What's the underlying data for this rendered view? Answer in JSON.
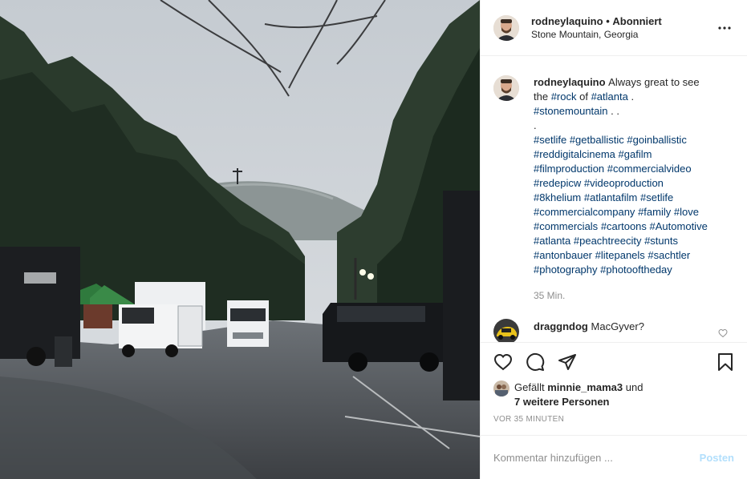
{
  "header": {
    "username": "rodneylaquino",
    "separator": "•",
    "follow_status": "Abonniert",
    "location": "Stone Mountain, Georgia"
  },
  "caption": {
    "username": "rodneylaquino",
    "lines": [
      {
        "parts": [
          {
            "t": "Always great to see",
            "tag": false
          }
        ]
      },
      {
        "parts": [
          {
            "t": "the ",
            "tag": false
          },
          {
            "t": "#rock",
            "tag": true
          },
          {
            "t": " of ",
            "tag": false
          },
          {
            "t": "#atlanta",
            "tag": true
          },
          {
            "t": " .",
            "tag": false
          }
        ]
      },
      {
        "parts": [
          {
            "t": "#stonemountain",
            "tag": true
          },
          {
            "t": " . .",
            "tag": false
          }
        ]
      },
      {
        "parts": [
          {
            "t": ".",
            "tag": false
          }
        ]
      },
      {
        "parts": [
          {
            "t": "#setlife",
            "tag": true
          },
          {
            "t": " ",
            "tag": false
          },
          {
            "t": "#getballistic",
            "tag": true
          },
          {
            "t": " ",
            "tag": false
          },
          {
            "t": "#goinballistic",
            "tag": true
          }
        ]
      },
      {
        "parts": [
          {
            "t": "#reddigitalcinema",
            "tag": true
          },
          {
            "t": " ",
            "tag": false
          },
          {
            "t": "#gafilm",
            "tag": true
          }
        ]
      },
      {
        "parts": [
          {
            "t": "#filmproduction",
            "tag": true
          },
          {
            "t": " ",
            "tag": false
          },
          {
            "t": "#commercialvideo",
            "tag": true
          }
        ]
      },
      {
        "parts": [
          {
            "t": "#redepicw",
            "tag": true
          },
          {
            "t": " ",
            "tag": false
          },
          {
            "t": "#videoproduction",
            "tag": true
          }
        ]
      },
      {
        "parts": [
          {
            "t": "#8khelium",
            "tag": true
          },
          {
            "t": " ",
            "tag": false
          },
          {
            "t": "#atlantafilm",
            "tag": true
          },
          {
            "t": " ",
            "tag": false
          },
          {
            "t": "#setlife",
            "tag": true
          }
        ]
      },
      {
        "parts": [
          {
            "t": "#commercialcompany",
            "tag": true
          },
          {
            "t": " ",
            "tag": false
          },
          {
            "t": "#family",
            "tag": true
          },
          {
            "t": " ",
            "tag": false
          },
          {
            "t": "#love",
            "tag": true
          }
        ]
      },
      {
        "parts": [
          {
            "t": "#commercials",
            "tag": true
          },
          {
            "t": " ",
            "tag": false
          },
          {
            "t": "#cartoons",
            "tag": true
          },
          {
            "t": " ",
            "tag": false
          },
          {
            "t": "#Automotive",
            "tag": true
          }
        ]
      },
      {
        "parts": [
          {
            "t": "#atlanta",
            "tag": true
          },
          {
            "t": " ",
            "tag": false
          },
          {
            "t": "#peachtreecity",
            "tag": true
          },
          {
            "t": " ",
            "tag": false
          },
          {
            "t": "#stunts",
            "tag": true
          }
        ]
      },
      {
        "parts": [
          {
            "t": "#antonbauer",
            "tag": true
          },
          {
            "t": " ",
            "tag": false
          },
          {
            "t": "#litepanels",
            "tag": true
          },
          {
            "t": " ",
            "tag": false
          },
          {
            "t": "#sachtler",
            "tag": true
          }
        ]
      },
      {
        "parts": [
          {
            "t": "#photography",
            "tag": true
          },
          {
            "t": " ",
            "tag": false
          },
          {
            "t": "#photooftheday",
            "tag": true
          }
        ]
      }
    ],
    "time": "35 Min."
  },
  "comment": {
    "username": "draggndog",
    "text": "MacGyver?"
  },
  "likes": {
    "prefix": "Gefällt",
    "user": "minnie_mama3",
    "and": "und",
    "others": "7 weitere Personen"
  },
  "timestamp": "VOR 35 MINUTEN",
  "add_comment": {
    "placeholder": "Kommentar hinzufügen ...",
    "post_label": "Posten"
  },
  "icons": {
    "more": "more-options-icon",
    "like": "heart-icon",
    "comment": "comment-icon",
    "share": "share-icon",
    "save": "bookmark-icon"
  },
  "colors": {
    "hashtag": "#00376b",
    "muted": "#8e8e8e",
    "post_button_disabled": "#b2dffc",
    "border": "#efefef"
  }
}
